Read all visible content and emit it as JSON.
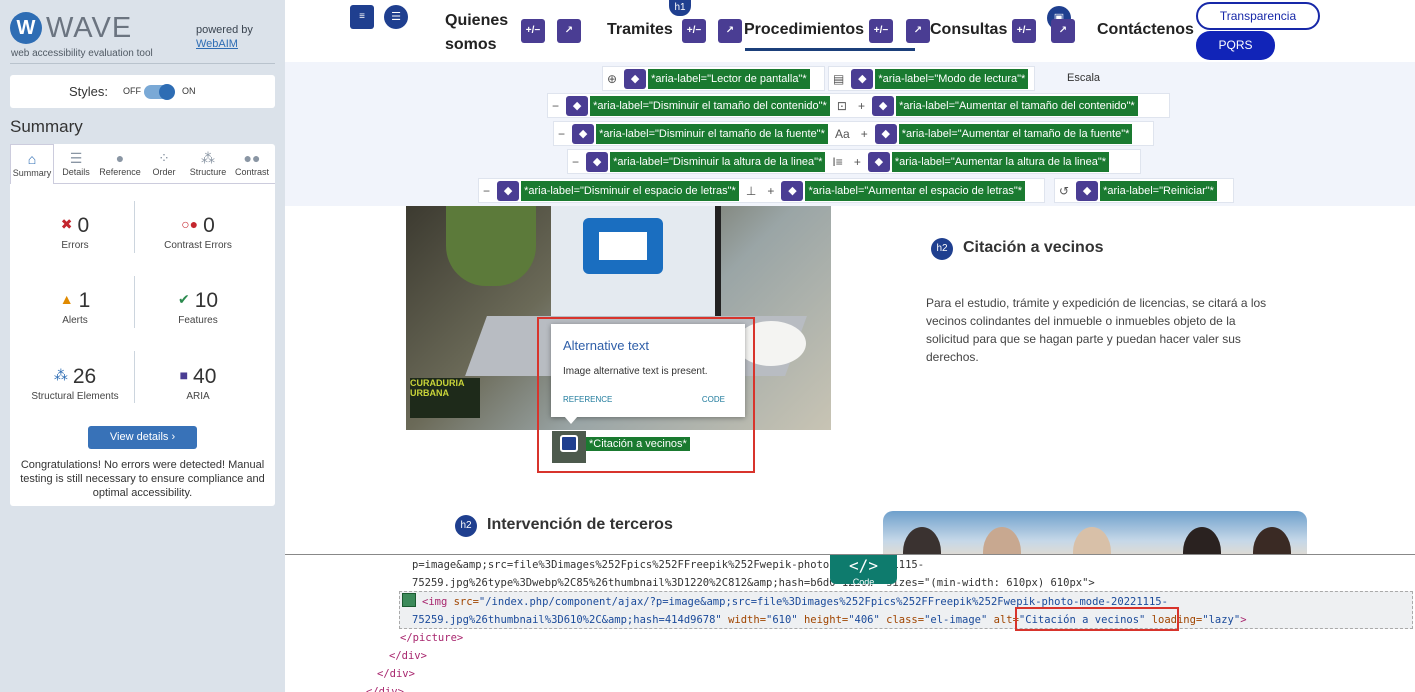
{
  "wave": {
    "logo_letter": "W",
    "logo_word": "WAVE",
    "subtitle": "web accessibility evaluation tool",
    "powered_by": "powered by",
    "webaim": "WebAIM",
    "styles_label": "Styles:",
    "styles_off": "OFF",
    "styles_on": "ON",
    "summary_title": "Summary",
    "tabs": [
      {
        "label": "Summary",
        "icon": "home-icon"
      },
      {
        "label": "Details",
        "icon": "list-icon"
      },
      {
        "label": "Reference",
        "icon": "info-icon"
      },
      {
        "label": "Order",
        "icon": "order-icon"
      },
      {
        "label": "Structure",
        "icon": "structure-icon"
      },
      {
        "label": "Contrast",
        "icon": "contrast-icon"
      }
    ],
    "stats": {
      "errors": {
        "count": "0",
        "label": "Errors"
      },
      "contrast": {
        "count": "0",
        "label": "Contrast Errors"
      },
      "alerts": {
        "count": "1",
        "label": "Alerts"
      },
      "features": {
        "count": "10",
        "label": "Features"
      },
      "structural": {
        "count": "26",
        "label": "Structural Elements"
      },
      "aria": {
        "count": "40",
        "label": "ARIA"
      }
    },
    "view_details": "View details ›",
    "congrats": "Congratulations! No errors were detected! Manual testing is still necessary to ensure compliance and optimal accessibility."
  },
  "nav": {
    "quienes1": "Quienes",
    "quienes2": "somos",
    "tramites": "Tramites",
    "procedimientos": "Procedimientos",
    "consultas": "Consultas",
    "contactenos": "Contáctenos",
    "h1": "h1",
    "transparencia": "Transparencia",
    "pqrs": "PQRS"
  },
  "access": {
    "lector": "*aria-label=\"Lector de pantalla\"*",
    "modo": "*aria-label=\"Modo de lectura\"*",
    "escala": "Escala",
    "dis_contenido": "*aria-label=\"Disminuir el tamaño del contenido\"*",
    "aum_contenido": "*aria-label=\"Aumentar el tamaño del contenido\"*",
    "dis_fuente": "*aria-label=\"Disminuir el tamaño de la fuente\"*",
    "aa": "Aa",
    "aum_fuente": "*aria-label=\"Aumentar el tamaño de la fuente\"*",
    "dis_altura": "*aria-label=\"Disminuir la altura de la linea\"*",
    "aum_altura": "*aria-label=\"Aumentar la altura de la linea\"*",
    "dis_letras": "*aria-label=\"Disminuir el espacio de letras\"*",
    "aum_letras": "*aria-label=\"Aumentar el espacio de letras\"*",
    "reiniciar": "*aria-label=\"Reiniciar\"*"
  },
  "content": {
    "h2": "h2",
    "title1": "Citación a vecinos",
    "para": "Para el estudio, trámite y expedición de licencias, se citará a los vecinos colindantes del inmueble o inmuebles objeto de la solicitud para que se hagan parte y puedan hacer valer sus derechos.",
    "title2": "Intervención de terceros",
    "logo_text": "CURADURIA URBANA",
    "popup_title": "Alternative text",
    "popup_desc": "Image alternative text is present.",
    "popup_ref": "REFERENCE",
    "popup_code": "CODE",
    "alt_label": "*Citación a vecinos*"
  },
  "code": {
    "toggle_symbol": "</>",
    "toggle_label": "Code",
    "line1": "p=image&amp;src=file%3Dimages%252Fpics%252FFreepik%252Fwepik-photo-mode-20221115-",
    "line2a": "75259.jpg%26type%3Dwebp%2C85%26thumbnail%3D1220%2C812&amp;hash=b6d0",
    "line2b": " 1220w\" sizes=\"(min-width: 610px) 610px\">",
    "img_open": "<img ",
    "img_src_attr": "src=",
    "img_src_val": "\"/index.php/component/ajax/?p=image&amp;src=file%3Dimages%252Fpics%252FFreepik%252Fwepik-photo-mode-20221115-",
    "line4": "75259.jpg%26thumbnail%3D610%2C&amp;hash=414d9678\"",
    "width_attr": " width=",
    "width_val": "\"610\"",
    "height_attr": " height=",
    "height_val": "\"406\"",
    "class_attr": " class=",
    "class_val": "\"el-image\"",
    "alt_attr": " alt=",
    "alt_val": "\"Citación a vecinos\"",
    "loading_attr": " loading=",
    "loading_val": "\"lazy\"",
    "close": ">",
    "picture_close": "</picture>",
    "div_close": "</div>"
  }
}
